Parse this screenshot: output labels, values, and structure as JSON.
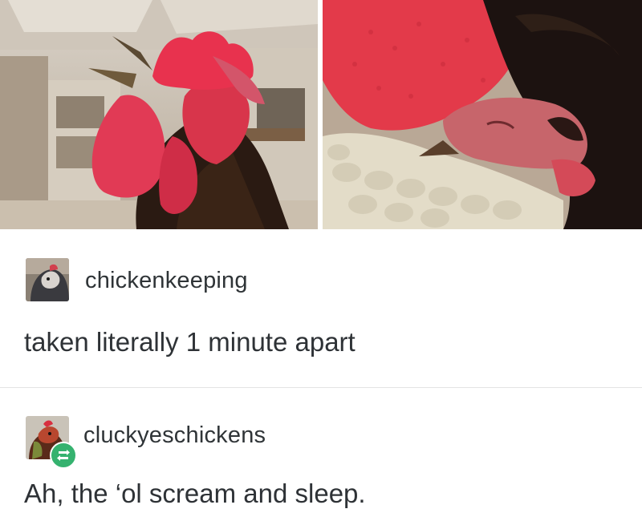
{
  "photos": {
    "left_alt_icon": "screaming-rooster-photo",
    "right_alt_icon": "sleeping-rooster-photo"
  },
  "posts": [
    {
      "username": "chickenkeeping",
      "text": "taken literally 1 minute apart"
    },
    {
      "username": "cluckyeschickens",
      "text": "Ah, the ‘ol scream and sleep.",
      "badge_icon": "reblog-icon"
    }
  ],
  "colors": {
    "reblog_badge": "#35b26f",
    "text": "#2e3236",
    "comb_red": "#e0303f"
  }
}
